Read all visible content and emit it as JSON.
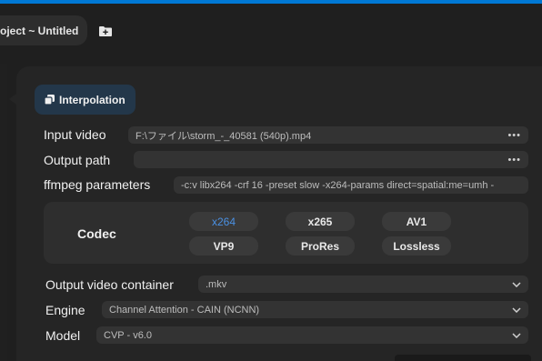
{
  "colors": {
    "accent": "#0078d4",
    "selected_codec_text": "#4a90e2",
    "badge_bg": "#23374a"
  },
  "header": {
    "project_tab": "oject ~ Untitled",
    "add_icon": "folder-plus-icon"
  },
  "section": {
    "badge_label": "Interpolation",
    "badge_icon": "copy-icon"
  },
  "form": {
    "input_video": {
      "label": "Input video",
      "value": "F:\\ファイル\\storm_-_40581 (540p).mp4",
      "action": "•••"
    },
    "output_path": {
      "label": "Output path",
      "value": "",
      "action": "•••"
    },
    "ffmpeg": {
      "label": "ffmpeg parameters",
      "value": "-c:v libx264 -crf 16 -preset slow -x264-params direct=spatial:me=umh -"
    },
    "codec": {
      "label": "Codec",
      "options": [
        "x264",
        "x265",
        "AV1",
        "VP9",
        "ProRes",
        "Lossless"
      ],
      "selected": "x264"
    },
    "container": {
      "label": "Output video container",
      "value": ".mkv"
    },
    "engine": {
      "label": "Engine",
      "value": "Channel Attention - CAIN (NCNN)"
    },
    "model": {
      "label": "Model",
      "value": "CVP - v6.0"
    }
  }
}
